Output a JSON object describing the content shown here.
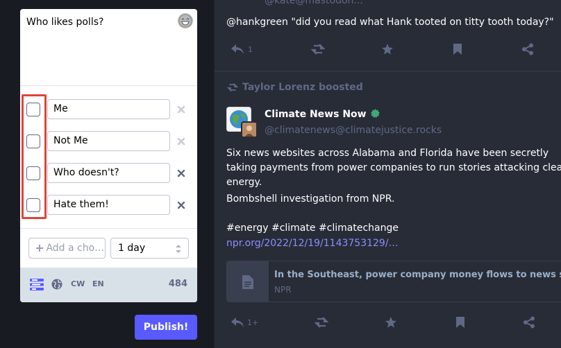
{
  "compose": {
    "text": "Who likes polls?",
    "emoji_icon": "grin-sweat-emoji-icon",
    "poll_choices": [
      {
        "value": "Me",
        "removable": false
      },
      {
        "value": "Not Me",
        "removable": false
      },
      {
        "value": "Who doesn't?",
        "removable": true
      },
      {
        "value": "Hate them!",
        "removable": true
      }
    ],
    "add_choice_placeholder": "Add a cho…",
    "duration": "1 day",
    "footer": {
      "cw_label": "CW",
      "lang_label": "EN",
      "char_count": "484"
    },
    "publish_label": "Publish!"
  },
  "colors": {
    "accent": "#595aff",
    "highlight": "#e0443a",
    "timeline_bg": "#282c37",
    "muted": "#606984",
    "link": "#8c8dff"
  },
  "timeline": {
    "faded_handle": "@kate@mastodon...",
    "status1": {
      "text": "@hankgreen \"did you read what Hank tooted on titty tooth today?\"",
      "reply_count": "1"
    },
    "status2": {
      "boosted_by": "Taylor Lorenz boosted",
      "display_name": "Climate News Now",
      "acct": "@climatenews@climatejustice.rocks",
      "paragraph1": "Six news websites across Alabama and Florida have been secretly taking payments from power companies to run stories attacking clean energy.",
      "paragraph2": "Bombshell investigation from NPR.",
      "hashtags": "#energy #climate #climatechange",
      "link": "npr.org/2022/12/19/1143753129/…",
      "card_title": "In the Southeast, power company money flows to news sites that attack clean energy",
      "card_host": "NPR",
      "reply_count": "1+"
    }
  }
}
